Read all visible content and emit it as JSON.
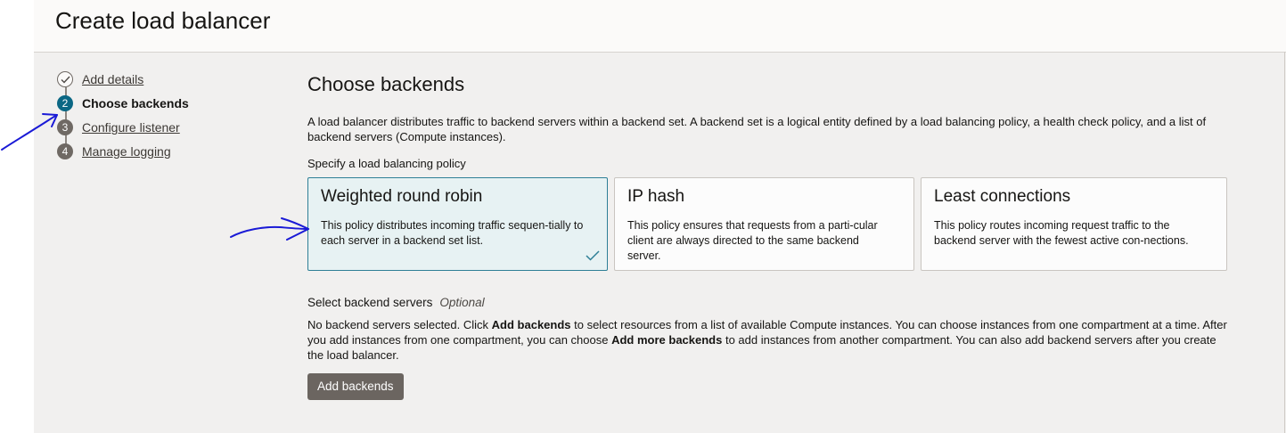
{
  "header": {
    "title": "Create load balancer"
  },
  "steps": [
    {
      "label": "Add details",
      "number": "1",
      "state": "completed"
    },
    {
      "label": "Choose backends",
      "number": "2",
      "state": "current"
    },
    {
      "label": "Configure listener",
      "number": "3",
      "state": "upcoming"
    },
    {
      "label": "Manage logging",
      "number": "4",
      "state": "upcoming"
    }
  ],
  "main": {
    "title": "Choose backends",
    "description": "A load balancer distributes traffic to backend servers within a backend set. A backend set is a logical entity defined by a load balancing policy, a health check policy, and a list of backend servers (Compute instances).",
    "policy_label": "Specify a load balancing policy",
    "policies": [
      {
        "title": "Weighted round robin",
        "description": "This policy distributes incoming traffic sequen-tially to each server in a backend set list.",
        "selected": true
      },
      {
        "title": "IP hash",
        "description": "This policy ensures that requests from a parti-cular client are always directed to the same backend server.",
        "selected": false
      },
      {
        "title": "Least connections",
        "description": "This policy routes incoming request traffic to the backend server with the fewest active con-nections.",
        "selected": false
      }
    ],
    "servers_label": "Select backend servers",
    "servers_optional": "Optional",
    "servers_desc": {
      "p1": "No backend servers selected. Click ",
      "b1": "Add backends",
      "p2": " to select resources from a list of available Compute instances. You can choose instances from one compartment at a time. After you add instances from one compartment, you can choose ",
      "b2": "Add more backends",
      "p3": " to add instances from another compartment. You can also add backend servers after you create the load balancer."
    },
    "add_button": "Add backends"
  },
  "colors": {
    "accent": "#0b6784",
    "selected_card_bg": "#e7f2f3",
    "button_bg": "#6b6560",
    "annotation_ink": "#1a1ad6"
  },
  "icons": [
    "check-icon",
    "checkmark-icon"
  ]
}
